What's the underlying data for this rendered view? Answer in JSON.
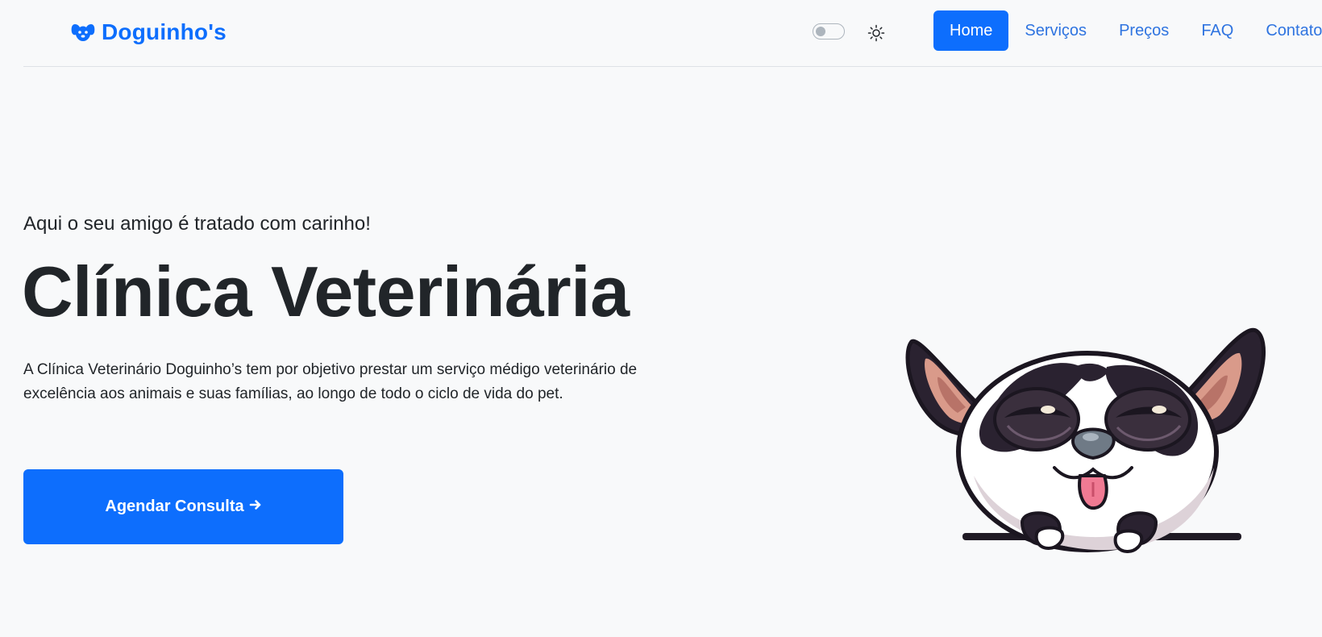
{
  "brand": {
    "name": "Doguinho's",
    "icon": "dog-face-icon"
  },
  "header": {
    "theme_toggle": {
      "state": "off"
    },
    "theme_icon": "sun-icon",
    "nav": [
      {
        "label": "Home",
        "active": true
      },
      {
        "label": "Serviços",
        "active": false
      },
      {
        "label": "Preços",
        "active": false
      },
      {
        "label": "FAQ",
        "active": false
      },
      {
        "label": "Contato",
        "active": false
      }
    ]
  },
  "hero": {
    "tagline": "Aqui o seu amigo é tratado com carinho!",
    "title": "Clínica Veterinária",
    "description": "A Clínica Veterinário Doguinho’s tem por objetivo prestar um serviço médigo veterinário de excelência aos animais e suas famílias, ao longo de todo o ciclo de vida do pet.",
    "cta_label": "Agendar Consulta",
    "cta_icon": "arrow-right-icon",
    "illustration": "dog-illustration"
  },
  "colors": {
    "primary": "#0d6efd",
    "background": "#f8f9fa",
    "text": "#212529",
    "link": "#2f74e0"
  }
}
